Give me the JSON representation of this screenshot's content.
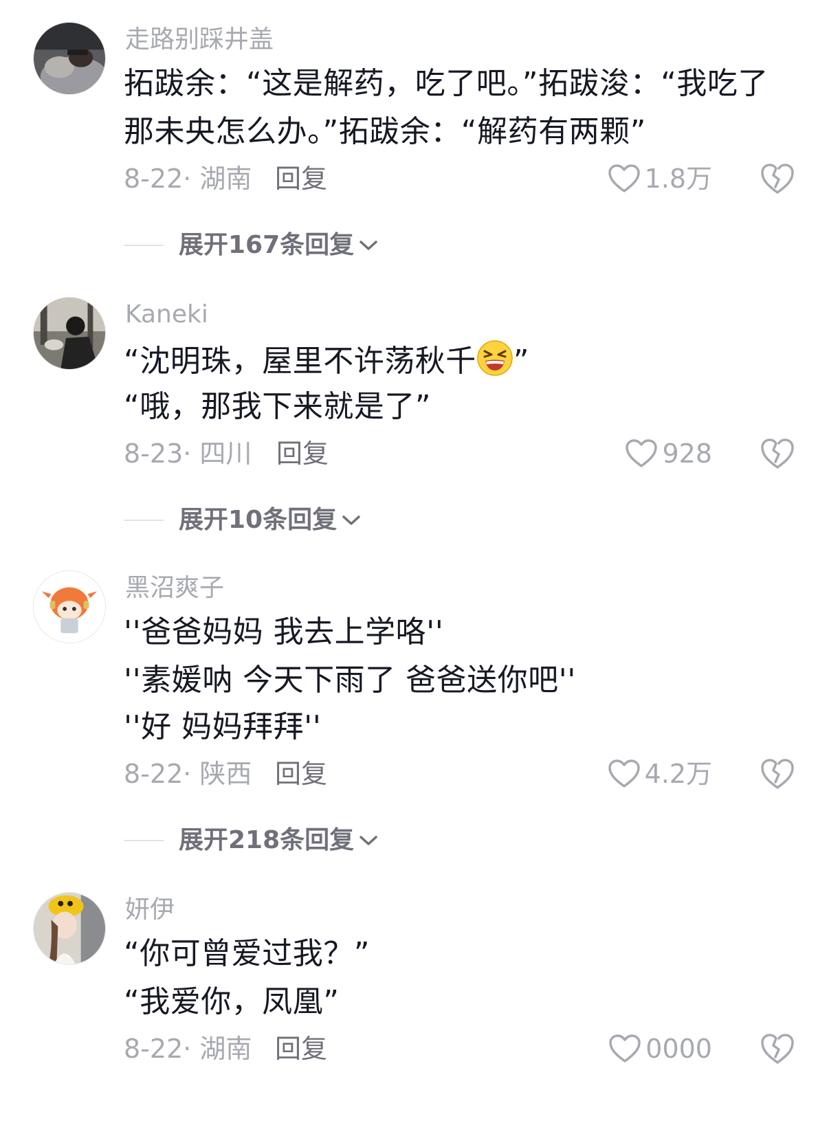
{
  "comments": [
    {
      "username": "走路别踩井盖",
      "lines": [
        "拓跋余：“这是解药，吃了吧。”拓跋浚：“我吃了",
        "那未央怎么办。”拓跋余：“解药有两颗”"
      ],
      "date_location": "8-22· 湖南",
      "reply_label": "回复",
      "likes": "1.8万",
      "expand_label": "展开167条回复"
    },
    {
      "username": "Kaneki",
      "lines": [
        "“沈明珠，屋里不许荡秋千",
        "“哦，那我下来就是了”"
      ],
      "line1_tail": "”",
      "date_location": "8-23· 四川",
      "reply_label": "回复",
      "likes": "928",
      "expand_label": "展开10条回复"
    },
    {
      "username": "黑沼爽子",
      "lines": [
        "''爸爸妈妈 我去上学咯''",
        "''素媛呐 今天下雨了 爸爸送你吧''",
        "''好 妈妈拜拜''"
      ],
      "date_location": "8-22· 陕西",
      "reply_label": "回复",
      "likes": "4.2万",
      "expand_label": "展开218条回复"
    },
    {
      "username": "妍伊",
      "lines": [
        "“你可曾爱过我？”",
        "“我爱你，凤凰”"
      ],
      "date_location": "8-22· 湖南",
      "reply_label": "回复",
      "likes": "0000"
    }
  ],
  "icons": {
    "like": "heart-outline-icon",
    "dislike": "broken-heart-icon",
    "expand": "chevron-down-icon",
    "emoji": "angry-grin-emoji"
  },
  "colors": {
    "primary_text": "#161823",
    "secondary_text": "#a7a9b0",
    "action_text": "#6f7079"
  }
}
